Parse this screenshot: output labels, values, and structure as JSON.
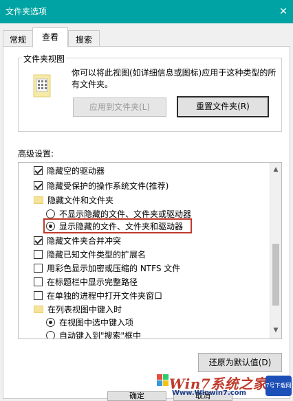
{
  "window": {
    "title": "文件夹选项",
    "close_glyph": "✕"
  },
  "tabs": [
    {
      "label": "常规",
      "active": false
    },
    {
      "label": "查看",
      "active": true
    },
    {
      "label": "搜索",
      "active": false
    }
  ],
  "folder_view": {
    "group_label": "文件夹视图",
    "description": "你可以将此视图(如详细信息或图标)应用于这种类型的所有文件夹。",
    "apply_button": "应用到文件夹(L)",
    "reset_button": "重置文件夹(R)"
  },
  "advanced": {
    "label": "高级设置:",
    "items": [
      {
        "type": "checkbox",
        "checked": true,
        "label": "隐藏空的驱动器",
        "indent": 0
      },
      {
        "type": "checkbox",
        "checked": true,
        "label": "隐藏受保护的操作系统文件(推荐)",
        "indent": 0
      },
      {
        "type": "folder",
        "label": "隐藏文件和文件夹",
        "indent": 0
      },
      {
        "type": "radio",
        "checked": false,
        "label": "不显示隐藏的文件、文件夹或驱动器",
        "indent": 1
      },
      {
        "type": "radio",
        "checked": true,
        "label": "显示隐藏的文件、文件夹和驱动器",
        "indent": 1
      },
      {
        "type": "checkbox",
        "checked": true,
        "label": "隐藏文件夹合并冲突",
        "indent": 0
      },
      {
        "type": "checkbox",
        "checked": false,
        "label": "隐藏已知文件类型的扩展名",
        "indent": 0
      },
      {
        "type": "checkbox",
        "checked": false,
        "label": "用彩色显示加密或压缩的 NTFS 文件",
        "indent": 0
      },
      {
        "type": "checkbox",
        "checked": false,
        "label": "在标题栏中显示完整路径",
        "indent": 0
      },
      {
        "type": "checkbox",
        "checked": false,
        "label": "在单独的进程中打开文件夹窗口",
        "indent": 0
      },
      {
        "type": "folder",
        "label": "在列表视图中键入时",
        "indent": 0
      },
      {
        "type": "radio",
        "checked": true,
        "label": "在视图中选中键入项",
        "indent": 1
      },
      {
        "type": "radio",
        "checked": false,
        "label": "自动键入到\"搜索\"框中",
        "indent": 1
      }
    ]
  },
  "restore_button": "还原为默认值(D)",
  "footer": {
    "ok_label": "确定",
    "cancel_label": "取消"
  },
  "watermark": {
    "brand": "Win7系统之家",
    "url": "Www.Winwin7.com",
    "badge": "7号下载网"
  },
  "colors": {
    "titlebar": "#00a3a3",
    "highlight_box": "#c0392b"
  }
}
